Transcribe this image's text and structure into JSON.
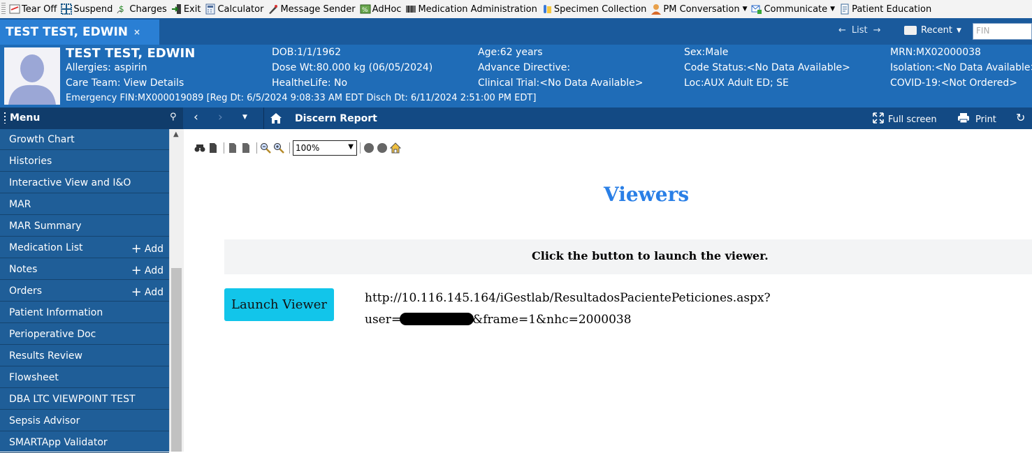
{
  "toolbar": {
    "items": [
      "Tear Off",
      "Suspend",
      "Charges",
      "Exit",
      "Calculator",
      "Message Sender",
      "AdHoc",
      "Medication Administration",
      "Specimen Collection",
      "PM Conversation",
      "Communicate",
      "Patient Education"
    ]
  },
  "patient_tab": {
    "name": "TEST TEST, EDWIN",
    "close": "×"
  },
  "nav": {
    "list": "List",
    "recent": "Recent",
    "fin_placeholder": "FIN"
  },
  "banner": {
    "name": "TEST TEST, EDWIN",
    "allergies": "Allergies: aspirin",
    "care_team": "Care Team: View Details",
    "encounter": "Emergency FIN:MX000019089 [Reg Dt: 6/5/2024 9:08:33 AM EDT Disch Dt: 6/11/2024 2:51:00 PM EDT]",
    "dob": "DOB:1/1/1962",
    "dose_wt": "Dose Wt:80.000 kg (06/05/2024)",
    "healthelife": "HealtheLife: No",
    "age": "Age:62 years",
    "advance_directive": "Advance Directive:",
    "clinical_trial": "Clinical Trial:<No Data Available>",
    "sex": "Sex:Male",
    "code_status": "Code Status:<No Data Available>",
    "loc": "Loc:AUX Adult ED; SE",
    "mrn": "MRN:MX02000038",
    "isolation": "Isolation:<No Data Available>",
    "covid": "COVID-19:<Not Ordered>"
  },
  "menu": {
    "title": "Menu",
    "add_label": "Add",
    "items": [
      {
        "label": "Growth Chart"
      },
      {
        "label": "Histories"
      },
      {
        "label": "Interactive View and I&O"
      },
      {
        "label": "MAR"
      },
      {
        "label": "MAR Summary"
      },
      {
        "label": "Medication List"
      },
      {
        "label": "Notes"
      },
      {
        "label": "Orders"
      },
      {
        "label": "Patient Information"
      },
      {
        "label": "Perioperative Doc"
      },
      {
        "label": "Results Review"
      },
      {
        "label": "Flowsheet"
      },
      {
        "label": "DBA LTC VIEWPOINT TEST"
      },
      {
        "label": "Sepsis Advisor"
      },
      {
        "label": "SMARTApp Validator"
      }
    ]
  },
  "content_nav": {
    "page_title": "Discern Report",
    "full_screen": "Full screen",
    "print": "Print"
  },
  "report": {
    "zoom": "100%",
    "title": "Viewers",
    "notice": "Click the button to launch the viewer.",
    "launch_label": "Launch Viewer",
    "url_line1": "http://10.116.145.164/iGestlab/ResultadosPacientePeticiones.aspx?",
    "url_prefix": "user=",
    "url_suffix": "&frame=1&nhc=2000038"
  }
}
